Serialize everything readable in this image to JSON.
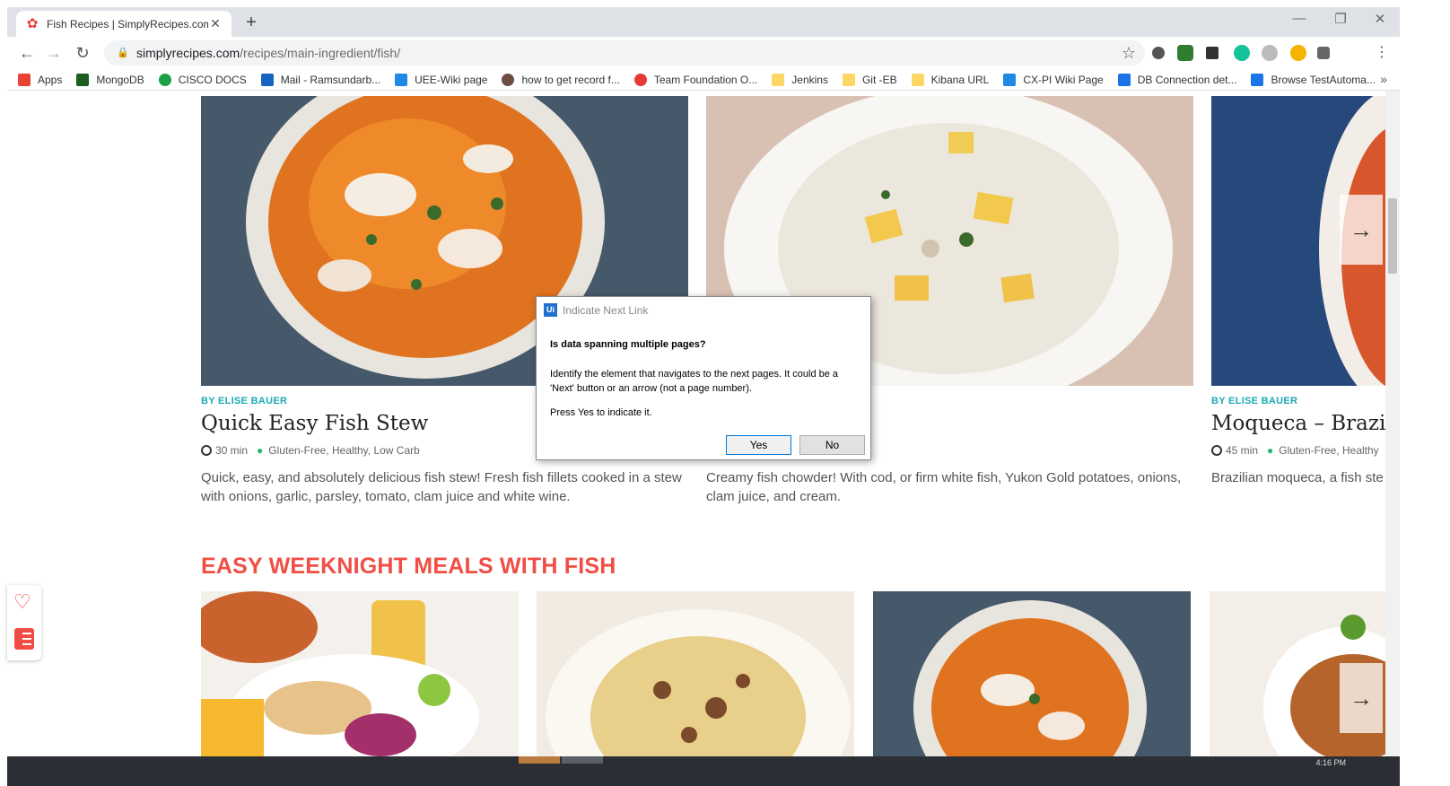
{
  "browser": {
    "tab_title": "Fish Recipes | SimplyRecipes.com",
    "url_host": "simplyrecipes.com",
    "url_path": "/recipes/main-ingredient/fish/",
    "bookmarks": [
      "Apps",
      "MongoDB",
      "CISCO DOCS",
      "Mail - Ramsundarb...",
      "UEE-Wiki page",
      "how to get record f...",
      "Team Foundation O...",
      "Jenkins",
      "Git -EB",
      "Kibana URL",
      "CX-PI Wiki Page",
      "DB Connection det...",
      "Browse TestAutoma..."
    ],
    "bookmark_colors": [
      "#e94235",
      "#1b5e20",
      "#1ba048",
      "#1565c0",
      "#1e88e5",
      "#6d4c41",
      "#e53935",
      "#fdd663",
      "#fdd663",
      "#fdd663",
      "#1e88e5",
      "#1a73e8",
      "#1a73e8"
    ]
  },
  "recipes": [
    {
      "byline": "BY ELISE BAUER",
      "title": "Quick Easy Fish Stew",
      "time": "30 min",
      "tags": "Gluten-Free, Healthy, Low Carb",
      "description": "Quick, easy, and absolutely delicious fish stew! Fresh fish fillets cooked in a stew with onions, garlic, parsley, tomato, clam juice and white wine."
    },
    {
      "description": "Creamy fish chowder! With cod, or firm white fish, Yukon Gold potatoes, onions, clam juice, and cream."
    },
    {
      "byline": "BY ELISE BAUER",
      "title": "Moqueca – Brazili",
      "time": "45 min",
      "tags": "Gluten-Free, Healthy",
      "description": "Brazilian moqueca, a fish ste peppers, tomatoes, cilantro,"
    }
  ],
  "section": {
    "title": "EASY WEEKNIGHT MEALS WITH FISH"
  },
  "dialog": {
    "app_logo": "Ui",
    "title": "Indicate Next Link",
    "question": "Is data spanning multiple pages?",
    "body": "Identify the element that navigates to the next pages. It could be a 'Next' button or an arrow (not a page number).",
    "prompt": "Press Yes to indicate it.",
    "yes_label": "Yes",
    "no_label": "No"
  },
  "icons": {
    "next_arrow": "→",
    "heart": "♡"
  },
  "taskbar": {
    "clock": "4:16 PM"
  }
}
